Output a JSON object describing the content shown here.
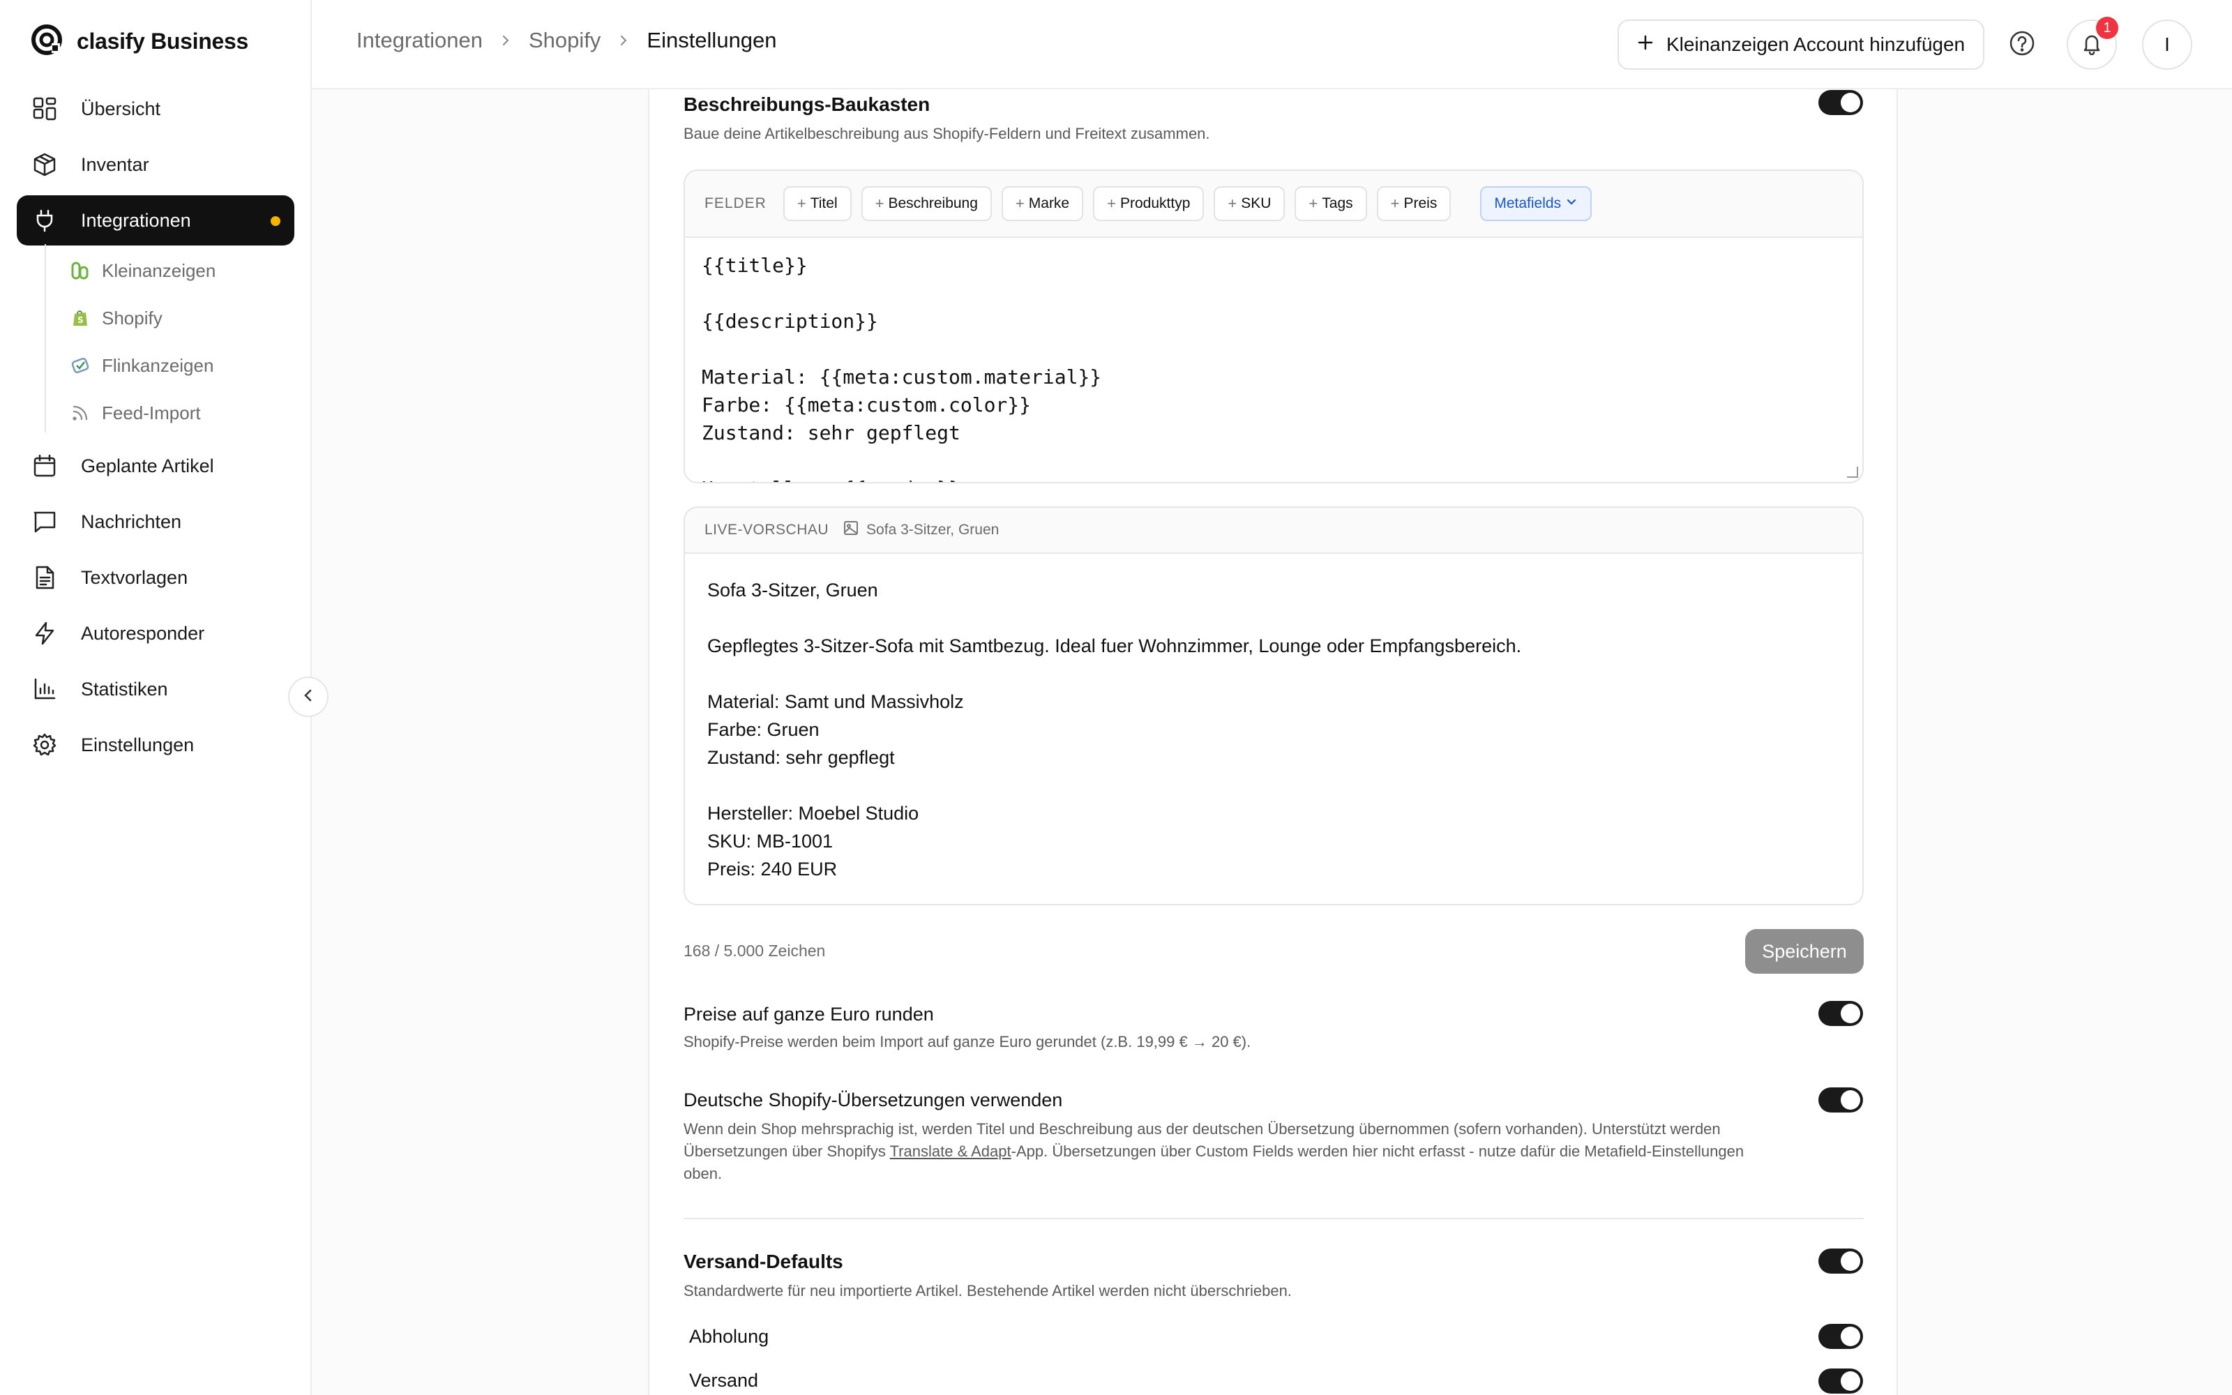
{
  "brand": {
    "name": "clasify Business"
  },
  "nav": {
    "items": [
      {
        "label": "Übersicht",
        "icon": "grid-icon"
      },
      {
        "label": "Inventar",
        "icon": "box-icon"
      },
      {
        "label": "Integrationen",
        "icon": "plug-icon",
        "active": true
      },
      {
        "label": "Geplante Artikel",
        "icon": "calendar-icon"
      },
      {
        "label": "Nachrichten",
        "icon": "message-icon"
      },
      {
        "label": "Textvorlagen",
        "icon": "document-icon"
      },
      {
        "label": "Autoresponder",
        "icon": "bolt-icon"
      },
      {
        "label": "Statistiken",
        "icon": "bar-chart-icon"
      },
      {
        "label": "Einstellungen",
        "icon": "gear-icon"
      }
    ],
    "sub_items": [
      {
        "label": "Kleinanzeigen",
        "icon": "kleinanzeigen-icon"
      },
      {
        "label": "Shopify",
        "icon": "shopify-icon"
      },
      {
        "label": "Flinkanzeigen",
        "icon": "flinkanzeigen-icon"
      },
      {
        "label": "Feed-Import",
        "icon": "rss-icon"
      }
    ]
  },
  "breadcrumb": [
    "Integrationen",
    "Shopify",
    "Einstellungen"
  ],
  "topbar": {
    "add_account_label": "Kleinanzeigen Account hinzufügen",
    "notification_count": "1",
    "avatar_initial": "I"
  },
  "builder": {
    "title": "Beschreibungs-Baukasten",
    "desc": "Baue deine Artikelbeschreibung aus Shopify-Feldern und Freitext zusammen.",
    "enabled": true,
    "fields_label": "FELDER",
    "chips": [
      "Titel",
      "Beschreibung",
      "Marke",
      "Produkttyp",
      "SKU",
      "Tags",
      "Preis"
    ],
    "metafields_label": "Metafields",
    "editor_text": "{{title}}\n\n{{description}}\n\nMaterial: {{meta:custom.material}}\nFarbe: {{meta:custom.color}}\nZustand: sehr gepflegt\n\nHersteller: {{vendor}}",
    "preview_label": "LIVE-VORSCHAU",
    "preview_product": "Sofa 3-Sitzer, Gruen",
    "preview_lines": [
      "Sofa 3-Sitzer, Gruen",
      "",
      "Gepflegtes 3-Sitzer-Sofa mit Samtbezug. Ideal fuer Wohnzimmer, Lounge oder Empfangsbereich.",
      "",
      "Material: Samt und Massivholz",
      "Farbe: Gruen",
      "Zustand: sehr gepflegt",
      "",
      "Hersteller: Moebel Studio",
      "SKU: MB-1001",
      "Preis: 240 EUR"
    ],
    "char_count": "168 / 5.000 Zeichen",
    "save_label": "Speichern"
  },
  "options": {
    "round": {
      "title": "Preise auf ganze Euro runden",
      "desc": "Shopify-Preise werden beim Import auf ganze Euro gerundet (z.B. 19,99 € → 20 €).",
      "enabled": true
    },
    "translations": {
      "title": "Deutsche Shopify-Übersetzungen verwenden",
      "desc_before": "Wenn dein Shop mehrsprachig ist, werden Titel und Beschreibung aus der deutschen Übersetzung übernommen (sofern vorhanden). Unterstützt werden Übersetzungen über Shopifys ",
      "desc_link": "Translate & Adapt",
      "desc_after": "-App. Übersetzungen über Custom Fields werden hier nicht erfasst - nutze dafür die Metafield-Einstellungen oben.",
      "enabled": true
    }
  },
  "shipping": {
    "title": "Versand-Defaults",
    "desc": "Standardwerte für neu importierte Artikel. Bestehende Artikel werden nicht überschrieben.",
    "enabled": true,
    "items": [
      {
        "label": "Abholung",
        "enabled": true
      },
      {
        "label": "Versand",
        "enabled": true
      }
    ]
  },
  "colors": {
    "accent_dot": "#f5b400",
    "badge": "#ef3340",
    "metafields": "#1a56c9"
  }
}
